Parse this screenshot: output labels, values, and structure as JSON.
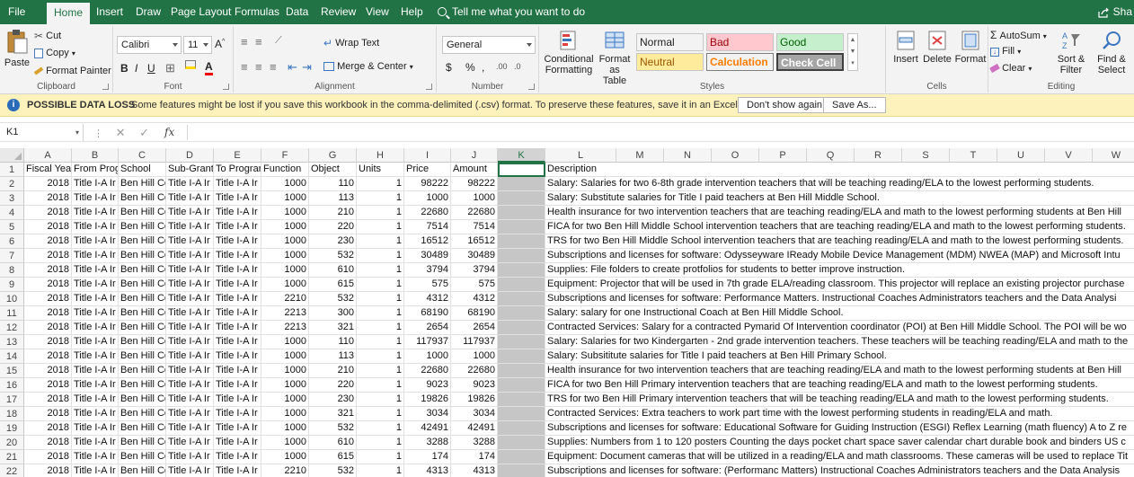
{
  "menu": {
    "tabs": [
      "File",
      "Home",
      "Insert",
      "Draw",
      "Page Layout",
      "Formulas",
      "Data",
      "Review",
      "View",
      "Help"
    ],
    "tell_me": "Tell me what you want to do",
    "share": "Sha"
  },
  "ribbon": {
    "clipboard": {
      "paste": "Paste",
      "cut": "Cut",
      "copy": "Copy",
      "format_painter": "Format Painter",
      "label": "Clipboard"
    },
    "font": {
      "name": "Calibri",
      "size": "11",
      "label": "Font"
    },
    "alignment": {
      "wrap_text": "Wrap Text",
      "merge_center": "Merge & Center",
      "label": "Alignment"
    },
    "number": {
      "format": "General",
      "currency": "$",
      "percent": "%",
      "comma": ",",
      "label": "Number"
    },
    "styles": {
      "conditional": "Conditional",
      "formatting": "Formatting",
      "format_as": "Format as",
      "table": "Table",
      "cells": [
        {
          "label": "Normal",
          "bg": "#ffffff",
          "fg": "#000000"
        },
        {
          "label": "Bad",
          "bg": "#ffc7ce",
          "fg": "#9c0006"
        },
        {
          "label": "Good",
          "bg": "#c6efce",
          "fg": "#006100"
        },
        {
          "label": "Neutral",
          "bg": "#ffeb9c",
          "fg": "#9c5700"
        },
        {
          "label": "Calculation",
          "bg": "#f2f2f2",
          "fg": "#fa7d00"
        },
        {
          "label": "Check Cell",
          "bg": "#a5a5a5",
          "fg": "#ffffff"
        }
      ],
      "label": "Styles"
    },
    "cells_grp": {
      "insert": "Insert",
      "delete": "Delete",
      "format": "Format",
      "label": "Cells"
    },
    "editing": {
      "autosum": "AutoSum",
      "fill": "Fill",
      "clear": "Clear",
      "sort": "Sort &",
      "filter": "Filter",
      "find": "Find &",
      "select": "Select",
      "label": "Editing"
    }
  },
  "message_bar": {
    "title": "POSSIBLE DATA LOSS",
    "text": "Some features might be lost if you save this workbook in the comma-delimited (.csv) format. To preserve these features, save it in an Excel file format.",
    "dont_show": "Don't show again",
    "save_as": "Save As..."
  },
  "formula_bar": {
    "name_box": "K1",
    "fx": "fx",
    "value": ""
  },
  "sheet": {
    "columns": [
      "A",
      "B",
      "C",
      "D",
      "E",
      "F",
      "G",
      "H",
      "I",
      "J",
      "K",
      "L",
      "M",
      "N",
      "O",
      "P",
      "Q",
      "R",
      "S",
      "T",
      "U",
      "V",
      "W"
    ],
    "header_row": [
      "Fiscal Year",
      "From Prog",
      "School",
      "Sub-Grant",
      "To Prograr",
      "Function",
      "Object",
      "Units",
      "Price",
      "Amount",
      "",
      "Description"
    ],
    "rows": [
      [
        "2018",
        "Title I-A Ir",
        "Ben Hill County Middl",
        "Title I-A Ir",
        "1000",
        "110",
        "1",
        "98222",
        "98222",
        "",
        "Salary:  Salaries for two 6-8th grade intervention teachers that will be teaching reading/ELA to the lowest performing students."
      ],
      [
        "2018",
        "Title I-A Ir",
        "Ben Hill County Middl",
        "Title I-A Ir",
        "1000",
        "113",
        "1",
        "1000",
        "1000",
        "",
        "Salary:  Substitute salaries for Title I paid teachers at Ben Hill Middle School."
      ],
      [
        "2018",
        "Title I-A Ir",
        "Ben Hill County Middl",
        "Title I-A Ir",
        "1000",
        "210",
        "1",
        "22680",
        "22680",
        "",
        "Health insurance for two intervention teachers that are teaching reading/ELA and math to the lowest performing students at Ben Hill"
      ],
      [
        "2018",
        "Title I-A Ir",
        "Ben Hill County Middl",
        "Title I-A Ir",
        "1000",
        "220",
        "1",
        "7514",
        "7514",
        "",
        "FICA for two Ben Hill Middle School intervention teachers that are teaching reading/ELA and math to the lowest performing students."
      ],
      [
        "2018",
        "Title I-A Ir",
        "Ben Hill County Middl",
        "Title I-A Ir",
        "1000",
        "230",
        "1",
        "16512",
        "16512",
        "",
        "TRS for two Ben Hill Middle School intervention teachers that are teaching reading/ELA and math to the lowest performing students."
      ],
      [
        "2018",
        "Title I-A Ir",
        "Ben Hill County Middl",
        "Title I-A Ir",
        "1000",
        "532",
        "1",
        "30489",
        "30489",
        "",
        "Subscriptions and licenses for software:  Odysseyware  IReady  Mobile Device Management (MDM)  NWEA (MAP)  and Microsoft Intu"
      ],
      [
        "2018",
        "Title I-A Ir",
        "Ben Hill County Middl",
        "Title I-A Ir",
        "1000",
        "610",
        "1",
        "3794",
        "3794",
        "",
        "Supplies:  File folders to create protfolios for students to better improve instruction."
      ],
      [
        "2018",
        "Title I-A Ir",
        "Ben Hill County Middl",
        "Title I-A Ir",
        "1000",
        "615",
        "1",
        "575",
        "575",
        "",
        "Equipment:  Projector that will be used in 7th grade ELA/reading classroom.  This projector will replace an existing projector purchase"
      ],
      [
        "2018",
        "Title I-A Ir",
        "Ben Hill County Middl",
        "Title I-A Ir",
        "2210",
        "532",
        "1",
        "4312",
        "4312",
        "",
        "Subscriptions and licenses for software:  Performance Matters.  Instructional Coaches  Administrators  teachers  and the Data Analysi"
      ],
      [
        "2018",
        "Title I-A Ir",
        "Ben Hill County Middl",
        "Title I-A Ir",
        "2213",
        "300",
        "1",
        "68190",
        "68190",
        "",
        "Salary:  salary for one Instructional Coach at Ben Hill Middle School."
      ],
      [
        "2018",
        "Title I-A Ir",
        "Ben Hill County Middl",
        "Title I-A Ir",
        "2213",
        "321",
        "1",
        "2654",
        "2654",
        "",
        "Contracted Services:  Salary for a contracted Pymarid Of Intervention coordinator (POI) at Ben Hill Middle School.  The POI will be wo"
      ],
      [
        "2018",
        "Title I-A Ir",
        "Ben Hill County Prima",
        "Title I-A Ir",
        "1000",
        "110",
        "1",
        "117937",
        "117937",
        "",
        "Salary:  Salaries for two Kindergarten - 2nd grade intervention teachers.  These teachers will be teaching reading/ELA and math to the"
      ],
      [
        "2018",
        "Title I-A Ir",
        "Ben Hill County Prima",
        "Title I-A Ir",
        "1000",
        "113",
        "1",
        "1000",
        "1000",
        "",
        "Salary:  Subsititute salaries for Title I paid teachers at Ben Hill Primary School."
      ],
      [
        "2018",
        "Title I-A Ir",
        "Ben Hill County Prima",
        "Title I-A Ir",
        "1000",
        "210",
        "1",
        "22680",
        "22680",
        "",
        "Health insurance for two intervention teachers that are teaching reading/ELA and math to the lowest performing students at Ben Hill"
      ],
      [
        "2018",
        "Title I-A Ir",
        "Ben Hill County Prima",
        "Title I-A Ir",
        "1000",
        "220",
        "1",
        "9023",
        "9023",
        "",
        "FICA for two Ben Hill Primary intervention teachers that are teaching reading/ELA and math to the lowest performing students."
      ],
      [
        "2018",
        "Title I-A Ir",
        "Ben Hill County Prima",
        "Title I-A Ir",
        "1000",
        "230",
        "1",
        "19826",
        "19826",
        "",
        "TRS for two Ben Hill Primary intervention teachers that will be teaching reading/ELA and math to the lowest performing students."
      ],
      [
        "2018",
        "Title I-A Ir",
        "Ben Hill County Prima",
        "Title I-A Ir",
        "1000",
        "321",
        "1",
        "3034",
        "3034",
        "",
        "Contracted Services:  Extra teachers to work part time with the lowest performing students in reading/ELA and math."
      ],
      [
        "2018",
        "Title I-A Ir",
        "Ben Hill County Prima",
        "Title I-A Ir",
        "1000",
        "532",
        "1",
        "42491",
        "42491",
        "",
        "Subscriptions and licenses for software:  Educational Software for Guiding Instruction (ESGI)  Reflex Learning (math fluency)  A to Z re"
      ],
      [
        "2018",
        "Title I-A Ir",
        "Ben Hill County Prima",
        "Title I-A Ir",
        "1000",
        "610",
        "1",
        "3288",
        "3288",
        "",
        "Supplies:  Numbers from 1 to 120 posters  Counting the days pocket chart  space saver calendar chart  durable book and binders  US c"
      ],
      [
        "2018",
        "Title I-A Ir",
        "Ben Hill County Prima",
        "Title I-A Ir",
        "1000",
        "615",
        "1",
        "174",
        "174",
        "",
        "Equipment:  Document cameras  that will be utilized in a reading/ELA and math classrooms.  These cameras will be used to replace Tit"
      ],
      [
        "2018",
        "Title I-A Ir",
        "Ben Hill County Prima",
        "Title I-A Ir",
        "2210",
        "532",
        "1",
        "4313",
        "4313",
        "",
        "Subscriptions and licenses for software:  (Performanc Matters) Instructional Coaches  Administrators  teachers  and the Data Analysis"
      ]
    ]
  }
}
